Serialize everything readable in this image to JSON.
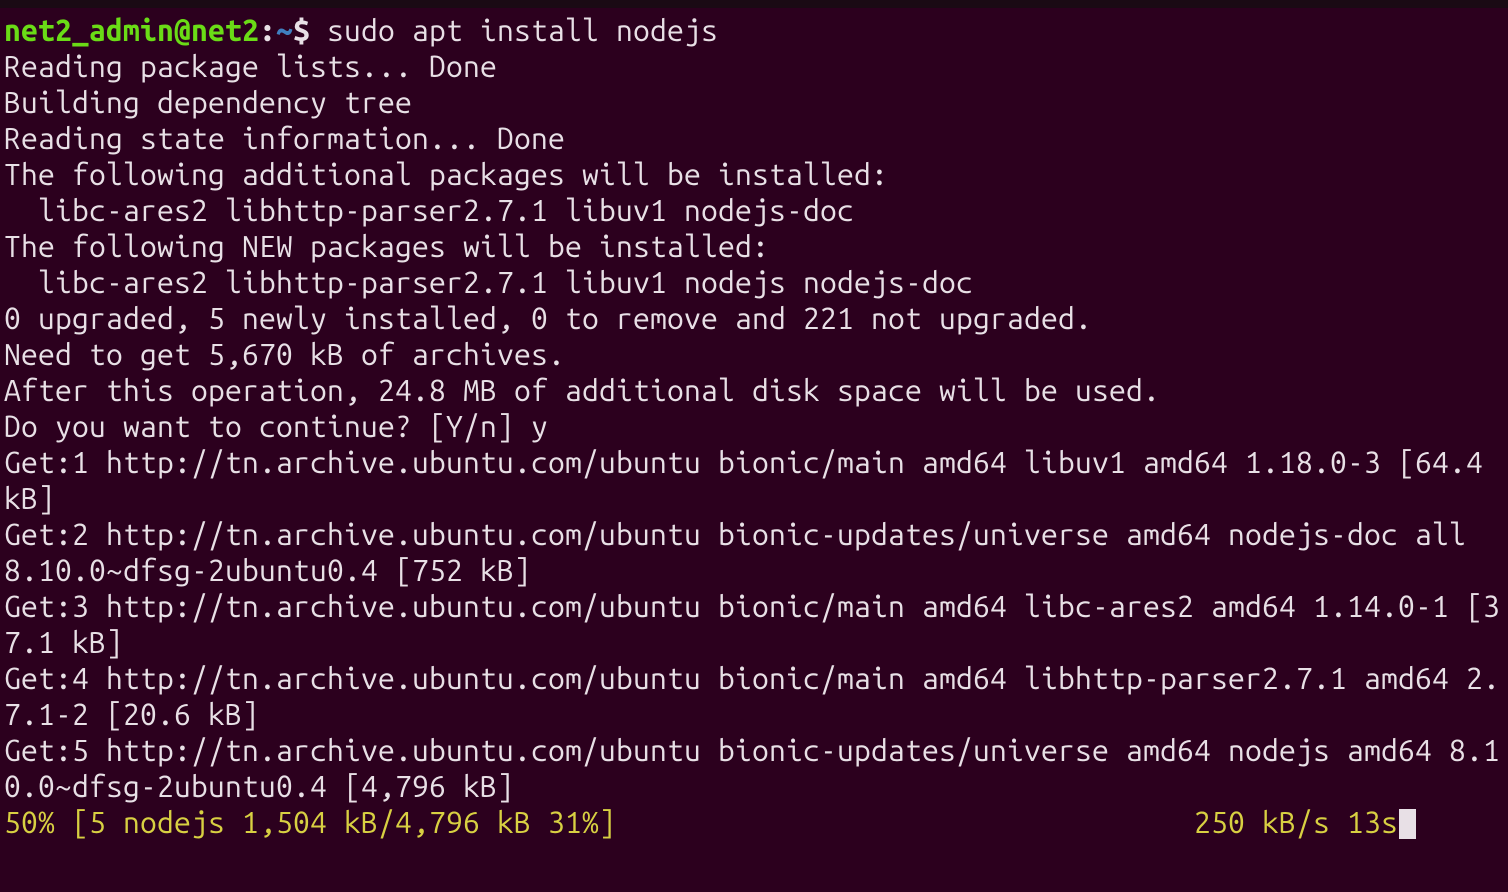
{
  "prompt": {
    "user": "net2_admin",
    "at": "@",
    "host": "net2",
    "colon": ":",
    "path": "~",
    "dollar": "$"
  },
  "command": "sudo apt install nodejs",
  "output": {
    "l1": "Reading package lists... Done",
    "l2": "Building dependency tree",
    "l3": "Reading state information... Done",
    "l4": "The following additional packages will be installed:",
    "l5": "  libc-ares2 libhttp-parser2.7.1 libuv1 nodejs-doc",
    "l6": "The following NEW packages will be installed:",
    "l7": "  libc-ares2 libhttp-parser2.7.1 libuv1 nodejs nodejs-doc",
    "l8": "0 upgraded, 5 newly installed, 0 to remove and 221 not upgraded.",
    "l9": "Need to get 5,670 kB of archives.",
    "l10": "After this operation, 24.8 MB of additional disk space will be used.",
    "l11": "Do you want to continue? [Y/n] y",
    "l12": "Get:1 http://tn.archive.ubuntu.com/ubuntu bionic/main amd64 libuv1 amd64 1.18.0-3 [64.4 kB]",
    "l13": "Get:2 http://tn.archive.ubuntu.com/ubuntu bionic-updates/universe amd64 nodejs-doc all 8.10.0~dfsg-2ubuntu0.4 [752 kB]",
    "l14": "Get:3 http://tn.archive.ubuntu.com/ubuntu bionic/main amd64 libc-ares2 amd64 1.14.0-1 [37.1 kB]",
    "l15": "Get:4 http://tn.archive.ubuntu.com/ubuntu bionic/main amd64 libhttp-parser2.7.1 amd64 2.7.1-2 [20.6 kB]",
    "l16": "Get:5 http://tn.archive.ubuntu.com/ubuntu bionic-updates/universe amd64 nodejs amd64 8.10.0~dfsg-2ubuntu0.4 [4,796 kB]"
  },
  "progress": {
    "left": "50% [5 nodejs 1,504 kB/4,796 kB 31%]",
    "right": "250 kB/s 13s"
  }
}
